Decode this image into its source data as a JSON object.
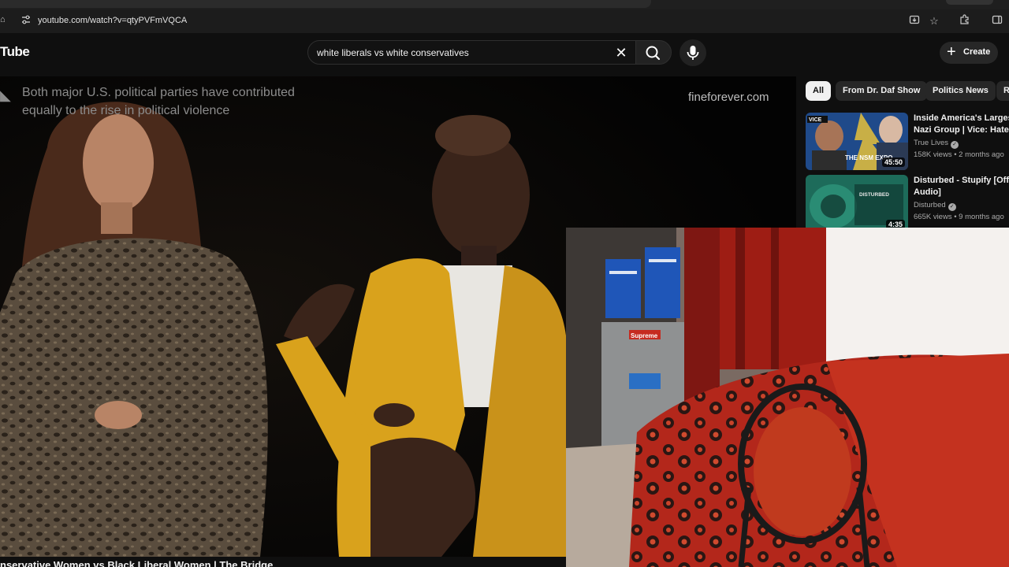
{
  "browser": {
    "url": "youtube.com/watch?v=qtyPVFmVQCA",
    "icons": [
      "home-icon",
      "site-info-icon",
      "install-app-icon",
      "bookmark-star-icon",
      "extensions-icon",
      "side-panel-icon"
    ]
  },
  "header": {
    "logo_text": "Tube",
    "search_query": "white liberals vs white conservatives",
    "create_label": "Create"
  },
  "video": {
    "overlay_lines": [
      "Both major U.S. political parties have contributed",
      "equally to the rise in political violence"
    ],
    "watermark": "fineforever.com",
    "title": "nservative Women vs Black Liberal Women | The Bridge"
  },
  "sidebar": {
    "chips": [
      "All",
      "From Dr. Daf Show",
      "Politics News",
      "R"
    ],
    "recommendations": [
      {
        "title_line1": "Inside America's Largest",
        "title_line2": "Nazi Group | Vice: Hate T",
        "channel": "True Lives",
        "stats": "158K views • 2 months ago",
        "duration": "45:50",
        "thumb_text": "THE NSM EXPO"
      },
      {
        "title_line1": "Disturbed - Stupify [Offici",
        "title_line2": "Audio]",
        "channel": "Disturbed",
        "stats": "665K views • 9 months ago",
        "duration": "4:35",
        "thumb_text": "DISTURBED"
      }
    ]
  },
  "colors": {
    "background": "#0f0f0f",
    "blazer": "#d9a21c",
    "bedspread": "#b3271b"
  }
}
